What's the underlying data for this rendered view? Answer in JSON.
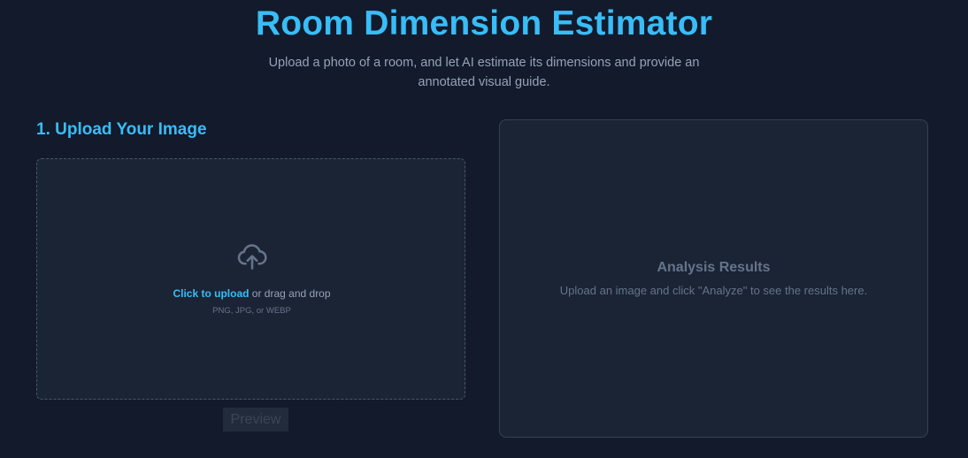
{
  "header": {
    "title": "Room Dimension Estimator",
    "subtitle": "Upload a photo of a room, and let AI estimate its dimensions and provide an annotated visual guide."
  },
  "upload_section": {
    "title": "1. Upload Your Image",
    "link_label": "Click to upload",
    "drag_text": " or drag and drop",
    "hint": "PNG, JPG, or WEBP",
    "icon": "cloud-upload-icon"
  },
  "preview_button": {
    "label": "Preview"
  },
  "results_panel": {
    "title": "Analysis Results",
    "message": "Upload an image and click \"Analyze\" to see the results here."
  },
  "colors": {
    "background": "#131a2b",
    "panel": "#1b2435",
    "accent": "#38bdf8",
    "muted": "#64748b",
    "text": "#94a3b8"
  }
}
